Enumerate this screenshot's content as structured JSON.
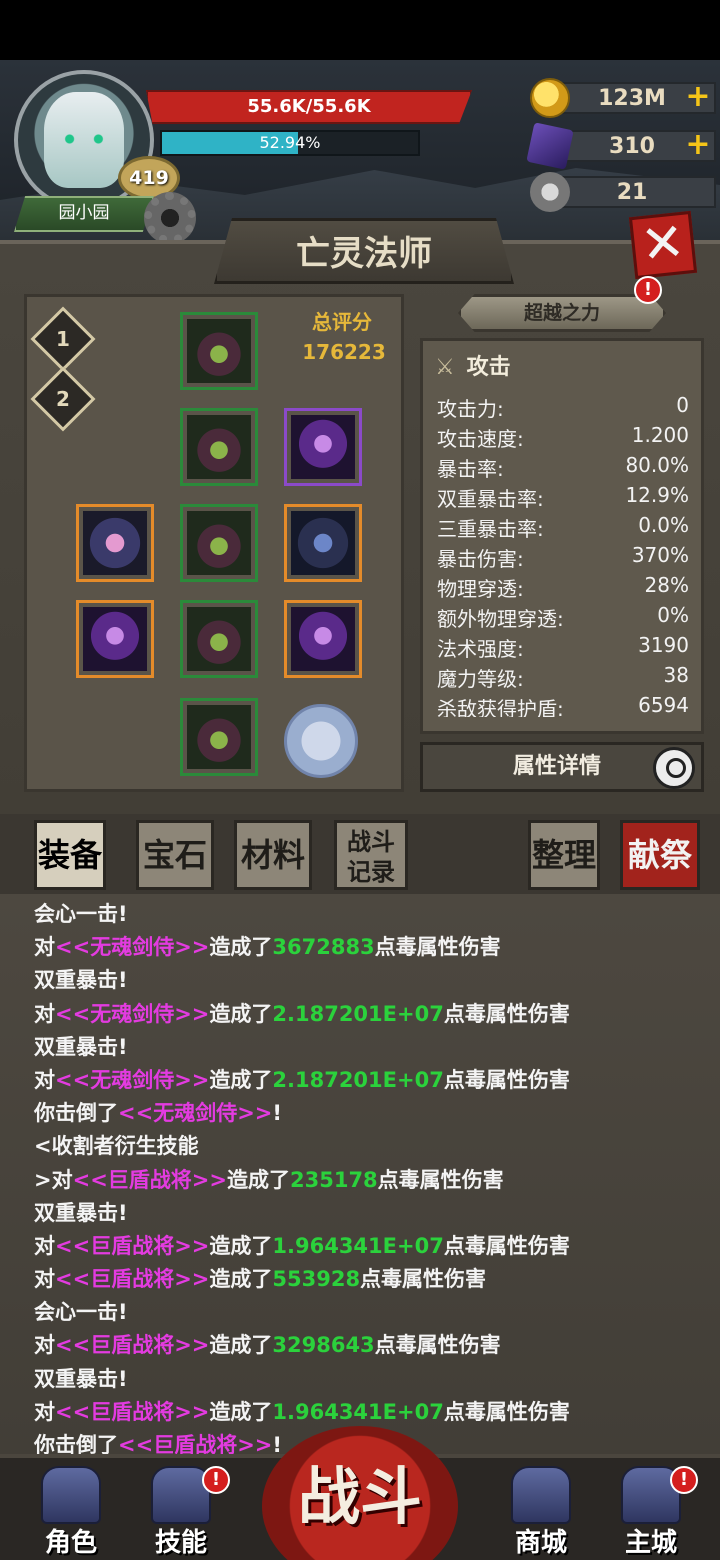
{
  "player": {
    "name": "园小园",
    "level": "419",
    "hp": "55.6K/55.6K",
    "xp_percent_text": "52.94%",
    "xp_percent": 0.5294
  },
  "resources": {
    "gold": "123M",
    "gems": "310",
    "tokens": "21",
    "plus": "+"
  },
  "panel": {
    "title": "亡灵法师",
    "close": "✕",
    "equip_tabs": [
      "1",
      "2"
    ],
    "score_label": "总评分",
    "score_value": "176223",
    "beyond_label": "超越之力",
    "alert": "!",
    "stats_header": "攻击",
    "stats": [
      {
        "label": "攻击力:",
        "value": "0"
      },
      {
        "label": "攻击速度:",
        "value": "1.200"
      },
      {
        "label": "暴击率:",
        "value": "80.0%"
      },
      {
        "label": "双重暴击率:",
        "value": "12.9%"
      },
      {
        "label": "三重暴击率:",
        "value": "0.0%"
      },
      {
        "label": "暴击伤害:",
        "value": "370%"
      },
      {
        "label": "物理穿透:",
        "value": "28%"
      },
      {
        "label": "额外物理穿透:",
        "value": "0%"
      },
      {
        "label": "法术强度:",
        "value": "3190"
      },
      {
        "label": "魔力等级:",
        "value": "38"
      },
      {
        "label": "杀敌获得护盾:",
        "value": "6594"
      }
    ],
    "detail_label": "属性详情"
  },
  "tabs": {
    "equipment": "装备",
    "gems": "宝石",
    "materials": "材料",
    "battle_log_1": "战斗",
    "battle_log_2": "记录",
    "organize": "整理",
    "sacrifice": "献祭"
  },
  "log": [
    [
      {
        "t": "会心一击!",
        "c": "w"
      }
    ],
    [
      {
        "t": "对",
        "c": "w"
      },
      {
        "t": "<<无魂剑侍>>",
        "c": "p"
      },
      {
        "t": "造成了",
        "c": "w"
      },
      {
        "t": "3672883",
        "c": "g"
      },
      {
        "t": "点毒属性伤害",
        "c": "w"
      }
    ],
    [
      {
        "t": "双重暴击!",
        "c": "w"
      }
    ],
    [
      {
        "t": "对",
        "c": "w"
      },
      {
        "t": "<<无魂剑侍>>",
        "c": "p"
      },
      {
        "t": "造成了",
        "c": "w"
      },
      {
        "t": "2.187201E+07",
        "c": "g"
      },
      {
        "t": "点毒属性伤害",
        "c": "w"
      }
    ],
    [
      {
        "t": "双重暴击!",
        "c": "w"
      }
    ],
    [
      {
        "t": "对",
        "c": "w"
      },
      {
        "t": "<<无魂剑侍>>",
        "c": "p"
      },
      {
        "t": "造成了",
        "c": "w"
      },
      {
        "t": "2.187201E+07",
        "c": "g"
      },
      {
        "t": "点毒属性伤害",
        "c": "w"
      }
    ],
    [
      {
        "t": "你击倒了",
        "c": "w"
      },
      {
        "t": "<<无魂剑侍>>",
        "c": "p"
      },
      {
        "t": "!",
        "c": "w"
      }
    ],
    [
      {
        "t": "<收割者衍生技能",
        "c": "w"
      }
    ],
    [
      {
        "t": ">对",
        "c": "w"
      },
      {
        "t": "<<巨盾战将>>",
        "c": "p"
      },
      {
        "t": "造成了",
        "c": "w"
      },
      {
        "t": "235178",
        "c": "g"
      },
      {
        "t": "点毒属性伤害",
        "c": "w"
      }
    ],
    [
      {
        "t": "双重暴击!",
        "c": "w"
      }
    ],
    [
      {
        "t": "对",
        "c": "w"
      },
      {
        "t": "<<巨盾战将>>",
        "c": "p"
      },
      {
        "t": "造成了",
        "c": "w"
      },
      {
        "t": "1.964341E+07",
        "c": "g"
      },
      {
        "t": "点毒属性伤害",
        "c": "w"
      }
    ],
    [
      {
        "t": "对",
        "c": "w"
      },
      {
        "t": "<<巨盾战将>>",
        "c": "p"
      },
      {
        "t": "造成了",
        "c": "w"
      },
      {
        "t": "553928",
        "c": "g"
      },
      {
        "t": "点毒属性伤害",
        "c": "w"
      }
    ],
    [
      {
        "t": "会心一击!",
        "c": "w"
      }
    ],
    [
      {
        "t": "对",
        "c": "w"
      },
      {
        "t": "<<巨盾战将>>",
        "c": "p"
      },
      {
        "t": "造成了",
        "c": "w"
      },
      {
        "t": "3298643",
        "c": "g"
      },
      {
        "t": "点毒属性伤害",
        "c": "w"
      }
    ],
    [
      {
        "t": "双重暴击!",
        "c": "w"
      }
    ],
    [
      {
        "t": "对",
        "c": "w"
      },
      {
        "t": "<<巨盾战将>>",
        "c": "p"
      },
      {
        "t": "造成了",
        "c": "w"
      },
      {
        "t": "1.964341E+07",
        "c": "g"
      },
      {
        "t": "点毒属性伤害",
        "c": "w"
      }
    ],
    [
      {
        "t": "你击倒了",
        "c": "w"
      },
      {
        "t": "<<巨盾战将>>",
        "c": "p"
      },
      {
        "t": "!",
        "c": "w"
      }
    ]
  ],
  "bottom_nav": {
    "character": "角色",
    "skills": "技能",
    "battle": "战斗",
    "shop": "商城",
    "city": "主城"
  },
  "colors": {
    "enemy_name": "#e33be0",
    "damage_number": "#2bd23c",
    "hp_bar": "#c1241f",
    "xp_bar": "#2fb3c6",
    "alert": "#d41e1e"
  }
}
